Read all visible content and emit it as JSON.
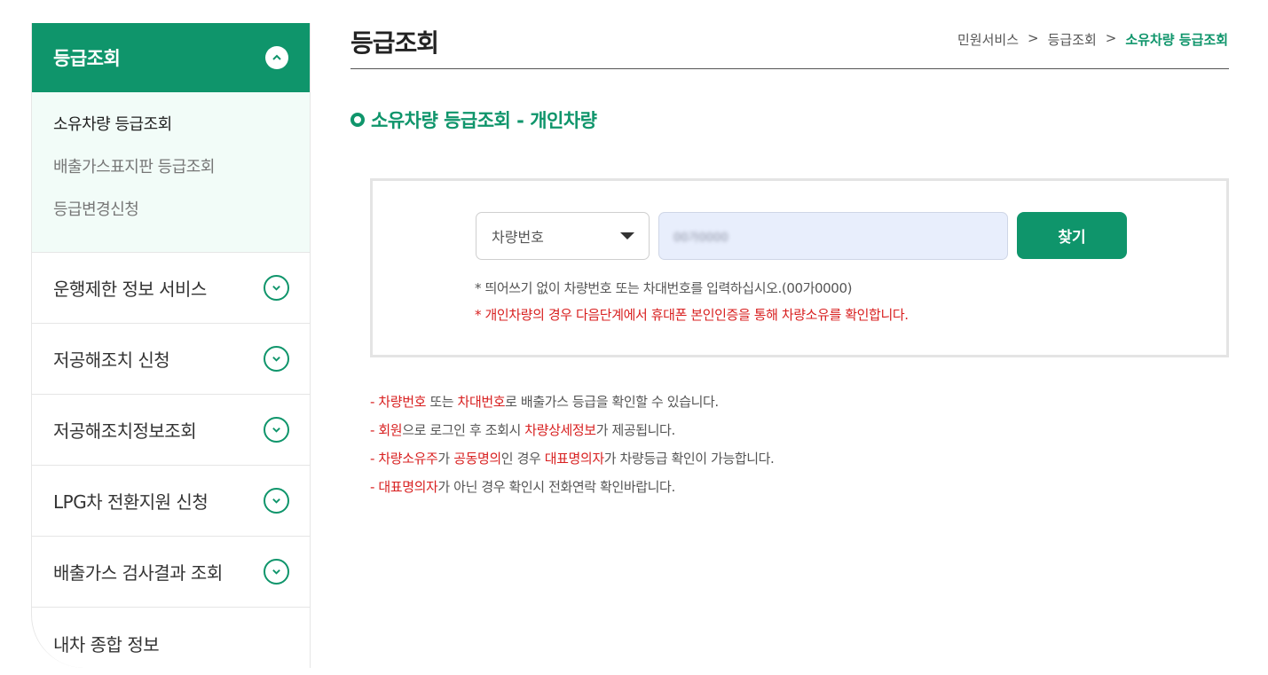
{
  "sidebar": {
    "header": "등급조회",
    "sub_items": [
      "소유차량 등급조회",
      "배출가스표지판 등급조회",
      "등급변경신청"
    ],
    "items": [
      "운행제한 정보 서비스",
      "저공해조치 신청",
      "저공해조치정보조회",
      "LPG차 전환지원 신청",
      "배출가스 검사결과 조회",
      "내차 종합 정보"
    ]
  },
  "page": {
    "title": "등급조회",
    "breadcrumb": [
      "민원서비스",
      "등급조회",
      "소유차량 등급조회"
    ],
    "breadcrumb_sep": ">"
  },
  "section": {
    "title": "소유차량 등급조회 - 개인차량"
  },
  "search": {
    "select_value": "차량번호",
    "input_value": "00가0000",
    "button": "찾기",
    "help_text": "* 띄어쓰기 없이 차량번호 또는 차대번호를 입력하십시오.(00가0000)",
    "warning_text": "* 개인차량의 경우 다음단계에서 휴대폰 본인인증을 통해 차량소유를 확인합니다."
  },
  "notes": [
    [
      "- ",
      "차량번호",
      " 또는 ",
      "차대번호",
      "로 배출가스 등급을 확인할 수 있습니다."
    ],
    [
      "- ",
      "회원",
      "으로 로그인 후 조회시 ",
      "차량상세정보",
      "가 제공됩니다."
    ],
    [
      "- ",
      "차량소유주",
      "가 ",
      "공동명의",
      "인 경우 ",
      "대표명의자",
      "가 차량등급 확인이 가능합니다."
    ],
    [
      "- ",
      "대표명의자",
      "가 아닌 경우 확인시 전화연락 확인바랍니다."
    ]
  ],
  "colors": {
    "brand": "#0f956b",
    "warning": "#d82020"
  }
}
